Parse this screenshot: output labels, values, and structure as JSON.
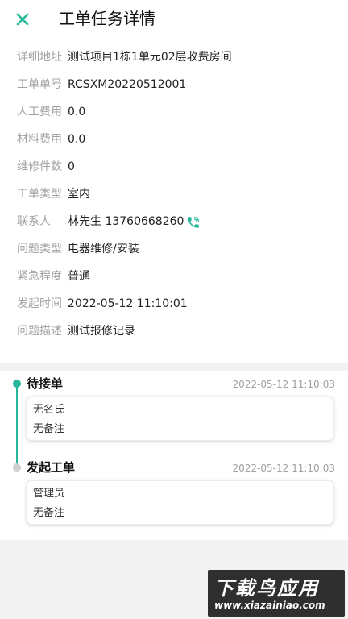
{
  "header": {
    "title": "工单任务详情"
  },
  "details": [
    {
      "label": "详细地址",
      "value": "测试项目1栋1单元02层收费房间"
    },
    {
      "label": "工单单号",
      "value": "RCSXM20220512001"
    },
    {
      "label": "人工费用",
      "value": "0.0"
    },
    {
      "label": "材料费用",
      "value": "0.0"
    },
    {
      "label": "维修件数",
      "value": "0"
    },
    {
      "label": "工单类型",
      "value": "室内"
    },
    {
      "label": "联系人",
      "value": "林先生 13760668260"
    },
    {
      "label": "问题类型",
      "value": "电器维修/安装"
    },
    {
      "label": "紧急程度",
      "value": "普通"
    },
    {
      "label": "发起时间",
      "value": "2022-05-12 11:10:01"
    },
    {
      "label": "问题描述",
      "value": "测试报修记录"
    }
  ],
  "timeline": [
    {
      "status": "待接单",
      "time": "2022-05-12 11:10:03",
      "person": "无名氏",
      "note": "无备注"
    },
    {
      "status": "发起工单",
      "time": "2022-05-12 11:10:03",
      "person": "管理员",
      "note": "无备注"
    }
  ],
  "watermark": {
    "brand": "下载鸟应用",
    "url": "www.xiazainiao.com"
  },
  "colors": {
    "accent": "#26b69b",
    "label": "#a3a3a3",
    "background": "#f2f2f2"
  }
}
